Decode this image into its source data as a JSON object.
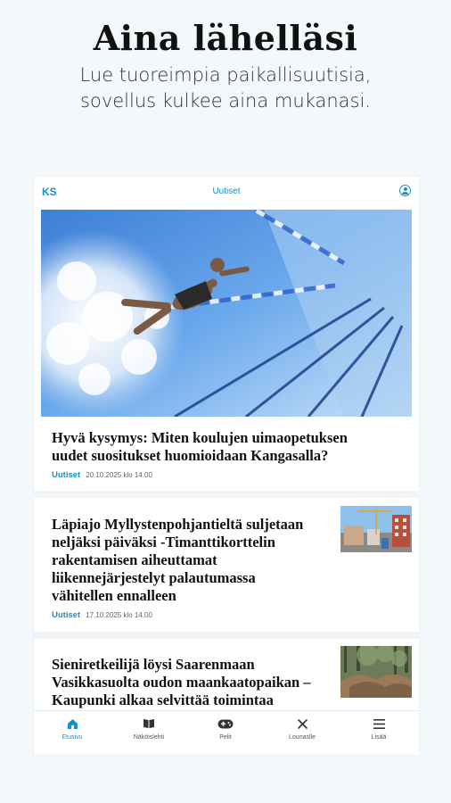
{
  "promo": {
    "title": "Aina lähelläsi",
    "subtitle_line1": "Lue tuoreimpia paikallisuutisia,",
    "subtitle_line2": "sovellus kulkee aina mukanasi."
  },
  "app": {
    "logo": "KS",
    "title": "Uutiset",
    "profile_icon": "profile-icon"
  },
  "articles": [
    {
      "headline": "Hyvä kysymys: Miten koulujen uimaopetuksen uudet suositukset huomioidaan Kangasalla?",
      "category": "Uutiset",
      "date": "20.10.2025 klo 14.00",
      "image": "swimmer-in-pool"
    },
    {
      "headline": "Läpiajo Myllystenpohjantieltä suljetaan neljäksi päiväksi -Timanttikorttelin rakentamisen aiheuttamat liikennejärjestelyt palautumassa vähitellen ennalleen",
      "category": "Uutiset",
      "date": "17.10.2025 klo 14.00",
      "image": "construction-site"
    },
    {
      "headline": "Sieniretkeilijä löysi Saarenmaan Vasikkasuolta oudon maankaatopaikan – Kaupunki alkaa selvittää toimintaa",
      "image": "forest-dirt-mounds"
    }
  ],
  "nav": [
    {
      "label": "Etusivu",
      "icon": "home-icon",
      "active": true
    },
    {
      "label": "Näköislehti",
      "icon": "book-icon",
      "active": false
    },
    {
      "label": "Pelit",
      "icon": "gamepad-icon",
      "active": false
    },
    {
      "label": "Lounaslle",
      "icon": "cutlery-icon",
      "active": false
    },
    {
      "label": "Lisää",
      "icon": "menu-icon",
      "active": false
    }
  ],
  "colors": {
    "accent": "#1a8fc4",
    "background": "#f3f8fb"
  }
}
